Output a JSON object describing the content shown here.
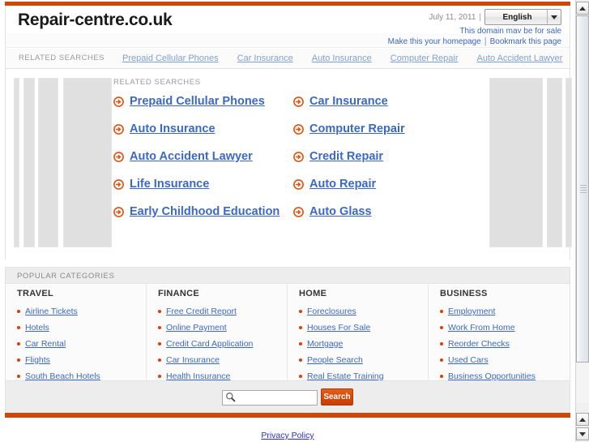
{
  "header": {
    "site_title": "Repair-centre.co.uk",
    "date": "July 11, 2011",
    "date_separator": "|",
    "language": "English",
    "for_sale_text": "This domain may be for sale",
    "homepage_link": "Make this your homepage",
    "link_separator": "|",
    "bookmark_link": "Bookmark this page"
  },
  "nav": {
    "label": "RELATED SEARCHES",
    "links": [
      "Prepaid Cellular Phones",
      "Car Insurance",
      "Auto Insurance",
      "Computer Repair",
      "Auto Accident Lawyer"
    ]
  },
  "related_searches": {
    "title": "RELATED SEARCHES",
    "items": [
      "Prepaid Cellular Phones",
      "Car Insurance",
      "Auto Insurance",
      "Computer Repair",
      "Auto Accident Lawyer",
      "Credit Repair",
      "Life Insurance",
      "Auto Repair",
      "Early Childhood Education",
      "Auto Glass"
    ]
  },
  "popular_categories": {
    "title": "POPULAR CATEGORIES",
    "columns": [
      {
        "heading": "TRAVEL",
        "links": [
          "Airline Tickets",
          "Hotels",
          "Car Rental",
          "Flights",
          "South Beach Hotels"
        ]
      },
      {
        "heading": "FINANCE",
        "links": [
          "Free Credit Report",
          "Online Payment",
          "Credit Card Application",
          "Car Insurance",
          "Health Insurance"
        ]
      },
      {
        "heading": "HOME",
        "links": [
          "Foreclosures",
          "Houses For Sale",
          "Mortgage",
          "People Search",
          "Real Estate Training"
        ]
      },
      {
        "heading": "BUSINESS",
        "links": [
          "Employment",
          "Work From Home",
          "Reorder Checks",
          "Used Cars",
          "Business Opportunities"
        ]
      }
    ]
  },
  "search": {
    "value": "",
    "placeholder": "",
    "button_label": "Search"
  },
  "footer": {
    "privacy_link": "Privacy Policy"
  },
  "colors": {
    "accent_orange": "#d14603",
    "link_blue": "#3b68c8",
    "nav_link_blue": "#7d9fd4",
    "bullet_red": "#e03c0a",
    "muted_gray": "#9a9a9a"
  }
}
